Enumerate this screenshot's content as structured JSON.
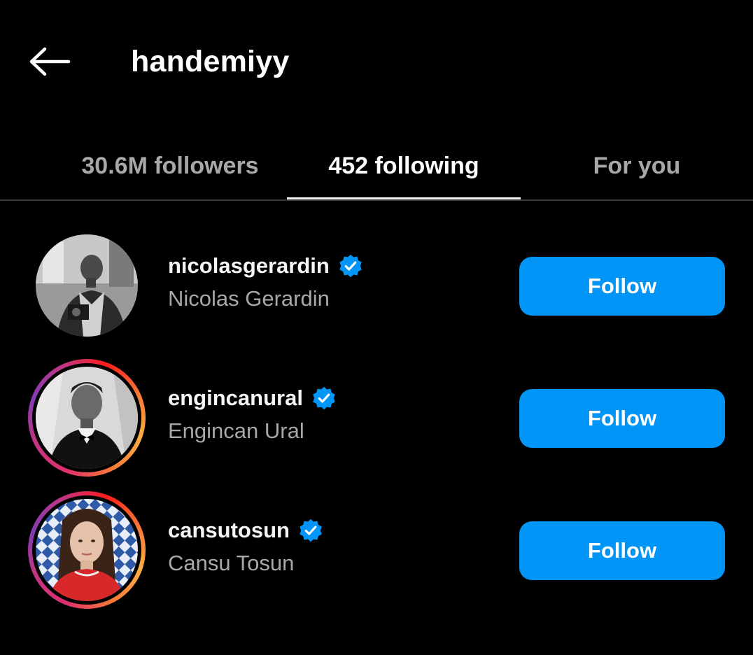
{
  "header": {
    "title": "handemiyy",
    "back_icon": "arrow-left-icon"
  },
  "tabs": [
    {
      "label": "30.6M followers",
      "active": false
    },
    {
      "label": "452 following",
      "active": true
    },
    {
      "label": "For you",
      "active": false
    }
  ],
  "colors": {
    "background": "#000000",
    "accent": "#0095f6",
    "secondary_text": "#a8a8a8",
    "verified": "#0095f6"
  },
  "users": [
    {
      "username": "nicolasgerardin",
      "full_name": "Nicolas Gerardin",
      "verified": true,
      "story_ring": false,
      "button_label": "Follow"
    },
    {
      "username": "engincanural",
      "full_name": "Engincan Ural",
      "verified": true,
      "story_ring": true,
      "button_label": "Follow"
    },
    {
      "username": "cansutosun",
      "full_name": "Cansu Tosun",
      "verified": true,
      "story_ring": true,
      "button_label": "Follow"
    }
  ]
}
